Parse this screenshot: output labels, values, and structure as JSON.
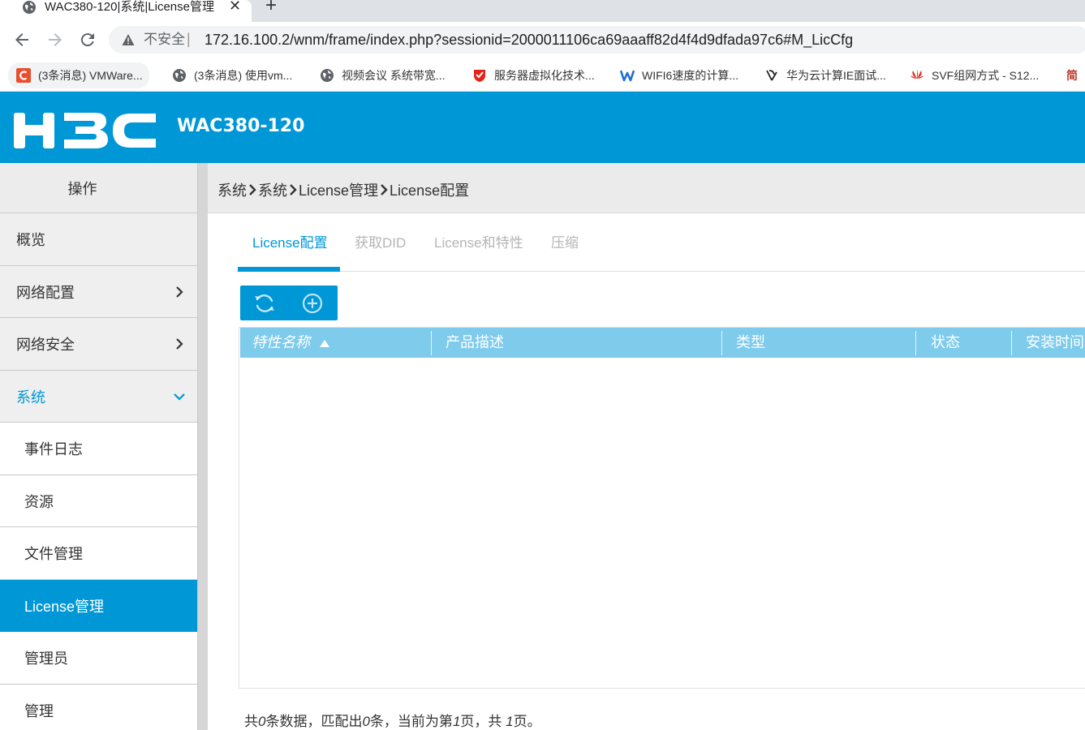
{
  "browser": {
    "tab_title": "WAC380-120|系统|License管理",
    "close_glyph": "✕",
    "new_tab_glyph": "+",
    "insecure_label": "不安全",
    "url_separator": "|",
    "url": "172.16.100.2/wnm/frame/index.php?sessionid=2000011106ca69aaaff82d4f4d9dfada97c6#M_LicCfg",
    "nav_icons": [
      "back-arrow-icon",
      "forward-arrow-icon",
      "reload-icon",
      "warning-icon"
    ],
    "bookmarks": [
      {
        "label": "(3条消息) VMWare...",
        "icon": "csdn-icon"
      },
      {
        "label": "(3条消息) 使用vm...",
        "icon": "globe-icon"
      },
      {
        "label": "视频会议 系统带宽...",
        "icon": "globe-icon"
      },
      {
        "label": "服务器虚拟化技术...",
        "icon": "shield-icon"
      },
      {
        "label": "WIFI6速度的计算...",
        "icon": "w-icon"
      },
      {
        "label": "华为云计算IE面试...",
        "icon": "ribbon-icon"
      },
      {
        "label": "SVF组网方式 - S12...",
        "icon": "huawei-icon"
      },
      {
        "label": "简",
        "icon": ""
      }
    ]
  },
  "app": {
    "logo_text": "H3C",
    "device_name": "WAC380-120",
    "brand_color": "#0097d6"
  },
  "sidebar": {
    "header": "操作",
    "items": [
      {
        "label": "概览"
      },
      {
        "label": "网络配置",
        "chevron": "chevron-right-icon"
      },
      {
        "label": "网络安全",
        "chevron": "chevron-right-icon"
      },
      {
        "label": "系统",
        "chevron": "chevron-down-icon",
        "expanded": true
      },
      {
        "label": "事件日志",
        "sub": true
      },
      {
        "label": "资源",
        "sub": true
      },
      {
        "label": "文件管理",
        "sub": true
      },
      {
        "label": "License管理",
        "sub": true,
        "selected": true
      },
      {
        "label": "管理员",
        "sub": true
      },
      {
        "label": "管理",
        "sub": true
      }
    ]
  },
  "breadcrumb": [
    "系统",
    "系统",
    "License管理",
    "License配置"
  ],
  "tabs": [
    {
      "label": "License配置",
      "active": true
    },
    {
      "label": "获取DID"
    },
    {
      "label": "License和特性"
    },
    {
      "label": "压缩"
    }
  ],
  "toolbar": {
    "buttons": [
      "refresh-icon",
      "add-circle-icon"
    ]
  },
  "grid": {
    "columns": [
      "特性名称",
      "产品描述",
      "类型",
      "状态",
      "安装时间"
    ],
    "sort_column": "特性名称",
    "sort_dir": "asc",
    "rows": []
  },
  "pager": {
    "p1": "共",
    "total": "0",
    "p2": "条数据，匹配出",
    "matched": "0",
    "p3": "条，当前为第",
    "page": "1",
    "p4": "页，共 ",
    "pages": "1",
    "p5": "页。"
  }
}
